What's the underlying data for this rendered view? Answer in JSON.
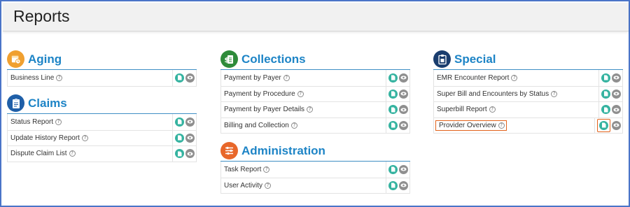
{
  "page": {
    "title": "Reports"
  },
  "colors": {
    "accent": "#1d84c6",
    "aging_icon": "#f0a030",
    "claims_icon": "#1f5fa8",
    "collections_icon": "#2e8b3a",
    "administration_icon": "#e8672a",
    "special_icon": "#1a3d6e",
    "doc_button": "#35b3a0",
    "view_button": "#8f8f8f",
    "highlight": "#e2621b"
  },
  "sections": {
    "aging": {
      "title": "Aging",
      "icon": "calendar-clock-icon",
      "items": [
        {
          "label": "Business Line"
        }
      ]
    },
    "claims": {
      "title": "Claims",
      "icon": "clipboard-icon",
      "items": [
        {
          "label": "Status Report"
        },
        {
          "label": "Update History Report"
        },
        {
          "label": "Dispute Claim List"
        }
      ]
    },
    "collections": {
      "title": "Collections",
      "icon": "dollar-document-icon",
      "items": [
        {
          "label": "Payment by Payer"
        },
        {
          "label": "Payment by Procedure"
        },
        {
          "label": "Payment by Payer Details"
        },
        {
          "label": "Billing and Collection"
        }
      ]
    },
    "administration": {
      "title": "Administration",
      "icon": "sliders-icon",
      "items": [
        {
          "label": "Task Report"
        },
        {
          "label": "User Activity"
        }
      ]
    },
    "special": {
      "title": "Special",
      "icon": "special-clipboard-icon",
      "items": [
        {
          "label": "EMR Encounter Report"
        },
        {
          "label": "Super Bill and Encounters by Status"
        },
        {
          "label": "Superbill Report"
        },
        {
          "label": "Provider Overview"
        }
      ]
    }
  },
  "help_glyph": "?"
}
